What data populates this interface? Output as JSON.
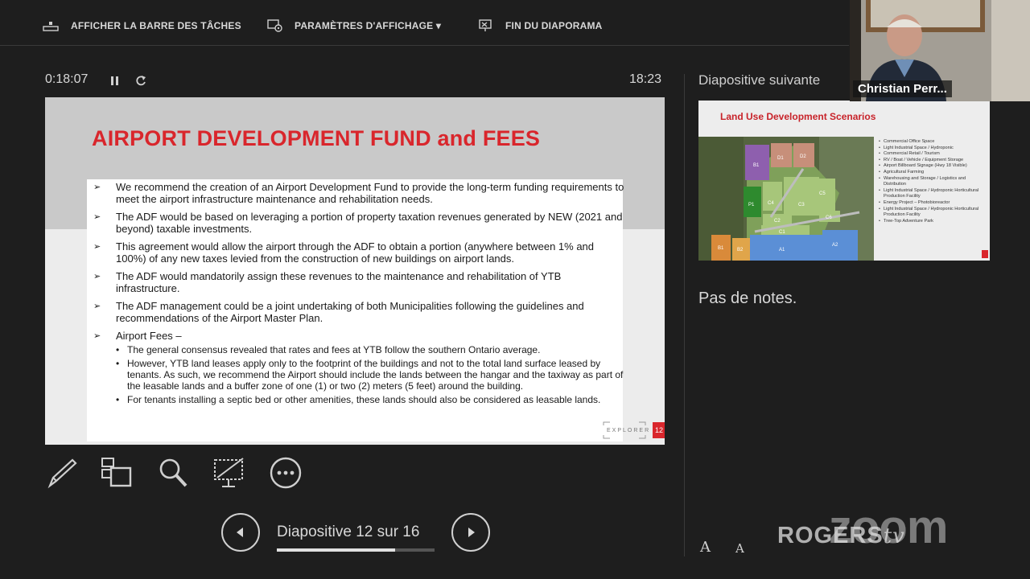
{
  "toolbar": {
    "taskbar_label": "AFFICHER LA BARRE DES TÂCHES",
    "display_settings_label": "PARAMÈTRES D'AFFICHAGE ▾",
    "end_show_label": "FIN DU DIAPORAMA"
  },
  "timer": {
    "elapsed": "0:18:07",
    "clock": "18:23"
  },
  "slide": {
    "title": "AIRPORT DEVELOPMENT FUND and FEES",
    "bullets": [
      "We recommend the creation of an Airport Development Fund to provide the long-term funding requirements to meet the airport infrastructure maintenance and rehabilitation needs.",
      "The ADF would be based on leveraging a portion of property taxation revenues generated by NEW (2021 and beyond) taxable investments.",
      "This agreement would allow the airport through the ADF to obtain a portion (anywhere between 1% and 100%) of any new taxes levied from the construction of new buildings on airport lands.",
      "The ADF would mandatorily assign these revenues to the maintenance and rehabilitation of YTB infrastructure.",
      "The ADF management could be a joint undertaking of both Municipalities following the guidelines and recommendations of the Airport Master Plan.",
      "Airport Fees –"
    ],
    "sub_bullets": [
      "The general consensus revealed that rates and fees at YTB follow the southern Ontario average.",
      "However, YTB land leases apply only to the footprint of the buildings and not to the total land surface leased by tenants. As such, we recommend the Airport should include the lands between the hangar and the taxiway as part of the leasable lands and a buffer zone of one (1) or two (2) meters (5 feet) around the building.",
      "For tenants installing a septic bed or other amenities, these lands should also be considered as leasable lands."
    ],
    "logo_text": "EXPLORER",
    "page_number": "12"
  },
  "navigation": {
    "label": "Diapositive 12 sur 16",
    "progress_fraction": 0.75
  },
  "next_slide": {
    "header": "Diapositive suivante",
    "title": "Land Use Development Scenarios",
    "legend": [
      "Commercial Office Space",
      "Light Industrial Space / Hydroponic",
      "Commercial Retail / Tourism",
      "RV / Boat / Vehicle / Equipment Storage",
      "Airport Billboard Signage (Hwy 18 Visible)",
      "Agricultural Farming",
      "Warehousing and Storage / Logistics and Distribution",
      "Light Industrial Space / Hydroponic Horticultural Production Facility",
      "Energy Project – Photobioreactor",
      "Light Industrial Space / Hydroponic Horticultural Production Facility",
      "Tree-Top Adventure Park"
    ],
    "map_labels": [
      "B1",
      "D1",
      "D2",
      "P1",
      "C4",
      "C3",
      "C5",
      "C2",
      "C6",
      "C1",
      "B1",
      "B2",
      "A1",
      "A2"
    ]
  },
  "notes": "Pas de notes.",
  "font_controls": {
    "increase": "A",
    "decrease": "A"
  },
  "participant": {
    "name": "Christian Perr..."
  },
  "watermarks": {
    "zoom": "zoom",
    "rogers": "ROGERS",
    "rogers_suffix": "tv"
  },
  "colors": {
    "slide_title": "#d9262c",
    "background": "#1e1e1e"
  }
}
